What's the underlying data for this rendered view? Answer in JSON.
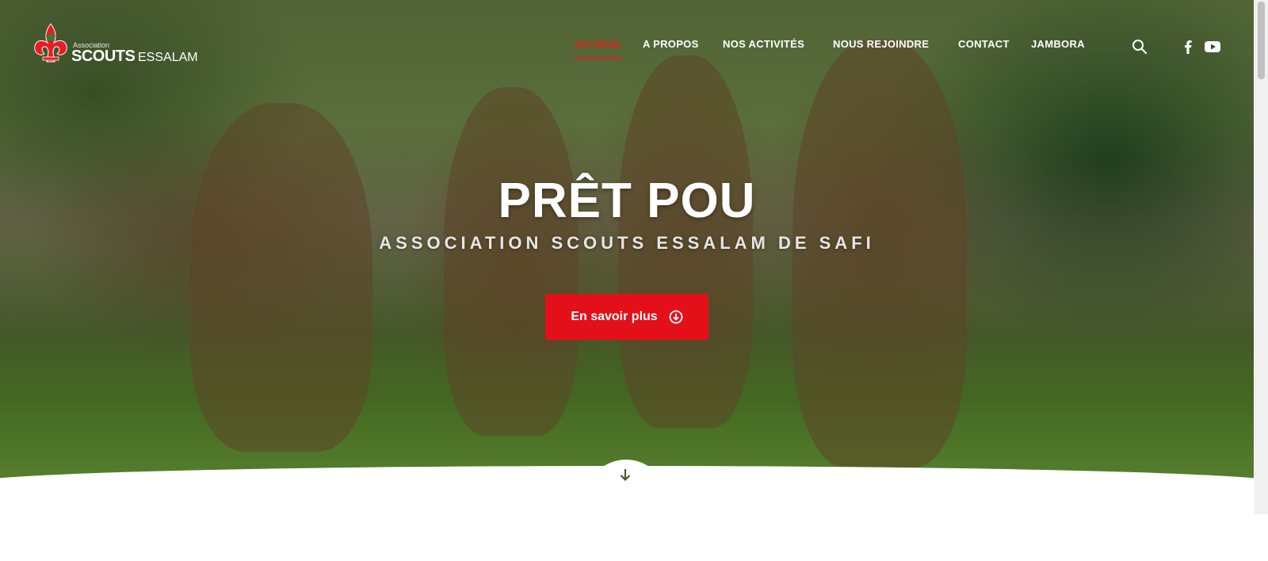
{
  "brand": {
    "logo_small": "Association",
    "logo_main": "SCOUTS",
    "logo_secondary": "ESSALAM",
    "emblem_color": "#e41d23"
  },
  "nav": {
    "items": [
      {
        "label": "ACCEUIL",
        "active": true
      },
      {
        "label": "A PROPOS",
        "active": false
      },
      {
        "label": "NOS ACTIVITÉS",
        "active": false
      },
      {
        "label": "NOUS REJOINDRE",
        "active": false
      },
      {
        "label": "CONTACT",
        "active": false
      },
      {
        "label": "JAMBORA",
        "active": false
      }
    ],
    "icons": [
      "search-icon",
      "facebook-icon",
      "youtube-icon"
    ]
  },
  "hero": {
    "title": "PRÊT POU",
    "subtitle": "ASSOCIATION SCOUTS ESSALAM DE SAFI",
    "cta_label": "En savoir plus",
    "cta_icon": "arrow-circle-down-icon",
    "scroll_icon": "arrow-down-icon"
  },
  "colors": {
    "accent": "#e41019",
    "nav_active": "#e41d23",
    "text_light": "#ffffff"
  }
}
